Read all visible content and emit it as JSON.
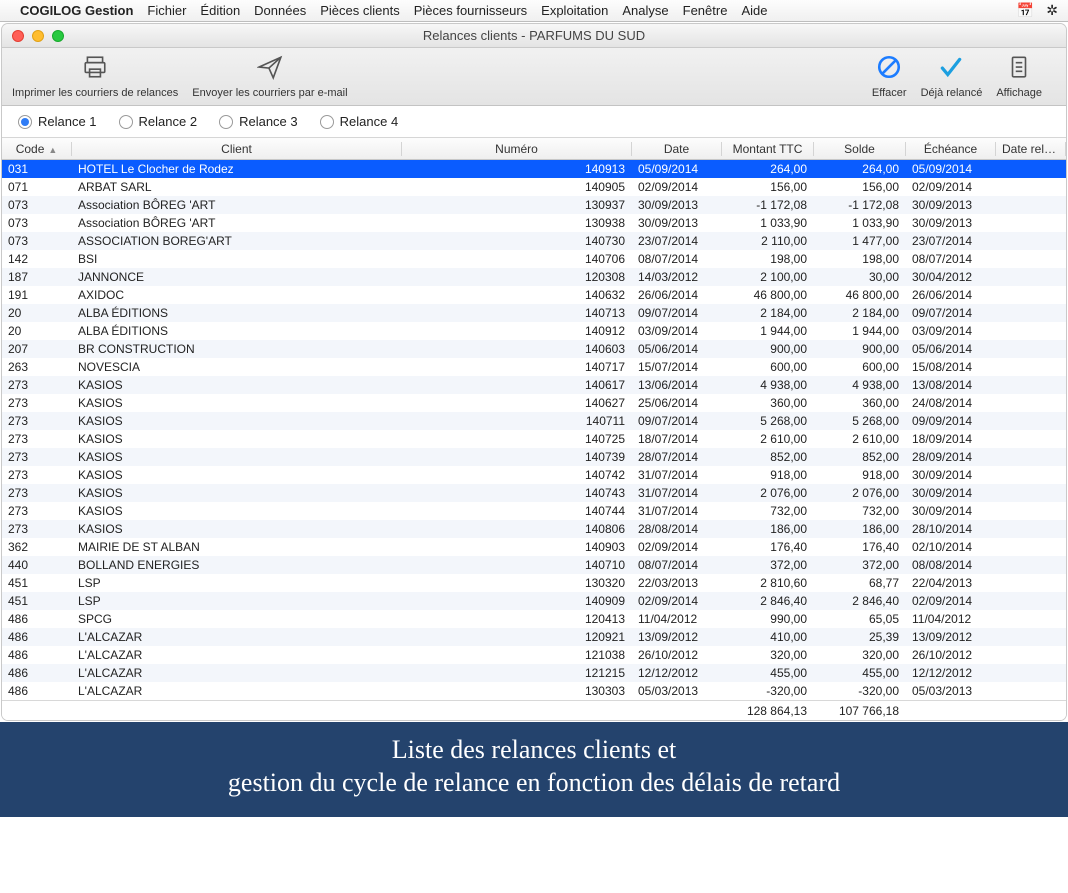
{
  "menubar": {
    "app": "COGILOG Gestion",
    "items": [
      "Fichier",
      "Édition",
      "Données",
      "Pièces clients",
      "Pièces fournisseurs",
      "Exploitation",
      "Analyse",
      "Fenêtre",
      "Aide"
    ]
  },
  "window": {
    "title": "Relances clients - PARFUMS DU SUD"
  },
  "toolbar": {
    "print": "Imprimer les courriers de relances",
    "send": "Envoyer les courriers par e-mail",
    "clear": "Effacer",
    "done": "Déjà relancé",
    "display": "Affichage"
  },
  "radios": {
    "r1": "Relance 1",
    "r2": "Relance 2",
    "r3": "Relance 3",
    "r4": "Relance 4",
    "selected": "r1"
  },
  "columns": {
    "code": "Code",
    "client": "Client",
    "numero": "Numéro",
    "date": "Date",
    "montant": "Montant TTC",
    "solde": "Solde",
    "echeance": "Échéance",
    "daterelance": "Date relance"
  },
  "rows": [
    {
      "code": "031",
      "client": "HOTEL Le Clocher de Rodez",
      "numero": "140913",
      "date": "05/09/2014",
      "montant": "264,00",
      "solde": "264,00",
      "echeance": "05/09/2014",
      "daterelance": "",
      "selected": true
    },
    {
      "code": "071",
      "client": "ARBAT SARL",
      "numero": "140905",
      "date": "02/09/2014",
      "montant": "156,00",
      "solde": "156,00",
      "echeance": "02/09/2014",
      "daterelance": ""
    },
    {
      "code": "073",
      "client": "Association BÔREG 'ART",
      "numero": "130937",
      "date": "30/09/2013",
      "montant": "-1 172,08",
      "solde": "-1 172,08",
      "echeance": "30/09/2013",
      "daterelance": ""
    },
    {
      "code": "073",
      "client": "Association BÔREG 'ART",
      "numero": "130938",
      "date": "30/09/2013",
      "montant": "1 033,90",
      "solde": "1 033,90",
      "echeance": "30/09/2013",
      "daterelance": ""
    },
    {
      "code": "073",
      "client": "ASSOCIATION BOREG'ART",
      "numero": "140730",
      "date": "23/07/2014",
      "montant": "2 110,00",
      "solde": "1 477,00",
      "echeance": "23/07/2014",
      "daterelance": ""
    },
    {
      "code": "142",
      "client": "BSI",
      "numero": "140706",
      "date": "08/07/2014",
      "montant": "198,00",
      "solde": "198,00",
      "echeance": "08/07/2014",
      "daterelance": ""
    },
    {
      "code": "187",
      "client": "JANNONCE",
      "numero": "120308",
      "date": "14/03/2012",
      "montant": "2 100,00",
      "solde": "30,00",
      "echeance": "30/04/2012",
      "daterelance": ""
    },
    {
      "code": "191",
      "client": "AXIDOC",
      "numero": "140632",
      "date": "26/06/2014",
      "montant": "46 800,00",
      "solde": "46 800,00",
      "echeance": "26/06/2014",
      "daterelance": ""
    },
    {
      "code": "20",
      "client": "ALBA ÉDITIONS",
      "numero": "140713",
      "date": "09/07/2014",
      "montant": "2 184,00",
      "solde": "2 184,00",
      "echeance": "09/07/2014",
      "daterelance": ""
    },
    {
      "code": "20",
      "client": "ALBA ÉDITIONS",
      "numero": "140912",
      "date": "03/09/2014",
      "montant": "1 944,00",
      "solde": "1 944,00",
      "echeance": "03/09/2014",
      "daterelance": ""
    },
    {
      "code": "207",
      "client": "BR CONSTRUCTION",
      "numero": "140603",
      "date": "05/06/2014",
      "montant": "900,00",
      "solde": "900,00",
      "echeance": "05/06/2014",
      "daterelance": ""
    },
    {
      "code": "263",
      "client": "NOVESCIA",
      "numero": "140717",
      "date": "15/07/2014",
      "montant": "600,00",
      "solde": "600,00",
      "echeance": "15/08/2014",
      "daterelance": ""
    },
    {
      "code": "273",
      "client": "KASIOS",
      "numero": "140617",
      "date": "13/06/2014",
      "montant": "4 938,00",
      "solde": "4 938,00",
      "echeance": "13/08/2014",
      "daterelance": ""
    },
    {
      "code": "273",
      "client": "KASIOS",
      "numero": "140627",
      "date": "25/06/2014",
      "montant": "360,00",
      "solde": "360,00",
      "echeance": "24/08/2014",
      "daterelance": ""
    },
    {
      "code": "273",
      "client": "KASIOS",
      "numero": "140711",
      "date": "09/07/2014",
      "montant": "5 268,00",
      "solde": "5 268,00",
      "echeance": "09/09/2014",
      "daterelance": ""
    },
    {
      "code": "273",
      "client": "KASIOS",
      "numero": "140725",
      "date": "18/07/2014",
      "montant": "2 610,00",
      "solde": "2 610,00",
      "echeance": "18/09/2014",
      "daterelance": ""
    },
    {
      "code": "273",
      "client": "KASIOS",
      "numero": "140739",
      "date": "28/07/2014",
      "montant": "852,00",
      "solde": "852,00",
      "echeance": "28/09/2014",
      "daterelance": ""
    },
    {
      "code": "273",
      "client": "KASIOS",
      "numero": "140742",
      "date": "31/07/2014",
      "montant": "918,00",
      "solde": "918,00",
      "echeance": "30/09/2014",
      "daterelance": ""
    },
    {
      "code": "273",
      "client": "KASIOS",
      "numero": "140743",
      "date": "31/07/2014",
      "montant": "2 076,00",
      "solde": "2 076,00",
      "echeance": "30/09/2014",
      "daterelance": ""
    },
    {
      "code": "273",
      "client": "KASIOS",
      "numero": "140744",
      "date": "31/07/2014",
      "montant": "732,00",
      "solde": "732,00",
      "echeance": "30/09/2014",
      "daterelance": ""
    },
    {
      "code": "273",
      "client": "KASIOS",
      "numero": "140806",
      "date": "28/08/2014",
      "montant": "186,00",
      "solde": "186,00",
      "echeance": "28/10/2014",
      "daterelance": ""
    },
    {
      "code": "362",
      "client": "MAIRIE  DE ST ALBAN",
      "numero": "140903",
      "date": "02/09/2014",
      "montant": "176,40",
      "solde": "176,40",
      "echeance": "02/10/2014",
      "daterelance": ""
    },
    {
      "code": "440",
      "client": "BOLLAND ENERGIES",
      "numero": "140710",
      "date": "08/07/2014",
      "montant": "372,00",
      "solde": "372,00",
      "echeance": "08/08/2014",
      "daterelance": ""
    },
    {
      "code": "451",
      "client": "LSP",
      "numero": "130320",
      "date": "22/03/2013",
      "montant": "2 810,60",
      "solde": "68,77",
      "echeance": "22/04/2013",
      "daterelance": ""
    },
    {
      "code": "451",
      "client": "LSP",
      "numero": "140909",
      "date": "02/09/2014",
      "montant": "2 846,40",
      "solde": "2 846,40",
      "echeance": "02/09/2014",
      "daterelance": ""
    },
    {
      "code": "486",
      "client": "SPCG",
      "numero": "120413",
      "date": "11/04/2012",
      "montant": "990,00",
      "solde": "65,05",
      "echeance": "11/04/2012",
      "daterelance": ""
    },
    {
      "code": "486",
      "client": "L'ALCAZAR",
      "numero": "120921",
      "date": "13/09/2012",
      "montant": "410,00",
      "solde": "25,39",
      "echeance": "13/09/2012",
      "daterelance": ""
    },
    {
      "code": "486",
      "client": "L'ALCAZAR",
      "numero": "121038",
      "date": "26/10/2012",
      "montant": "320,00",
      "solde": "320,00",
      "echeance": "26/10/2012",
      "daterelance": ""
    },
    {
      "code": "486",
      "client": "L'ALCAZAR",
      "numero": "121215",
      "date": "12/12/2012",
      "montant": "455,00",
      "solde": "455,00",
      "echeance": "12/12/2012",
      "daterelance": ""
    },
    {
      "code": "486",
      "client": "L'ALCAZAR",
      "numero": "130303",
      "date": "05/03/2013",
      "montant": "-320,00",
      "solde": "-320,00",
      "echeance": "05/03/2013",
      "daterelance": ""
    }
  ],
  "totals": {
    "montant": "128 864,13",
    "solde": "107 766,18"
  },
  "banner": {
    "line1": "Liste des relances clients et",
    "line2": "gestion du cycle de relance en fonction des délais de retard"
  }
}
